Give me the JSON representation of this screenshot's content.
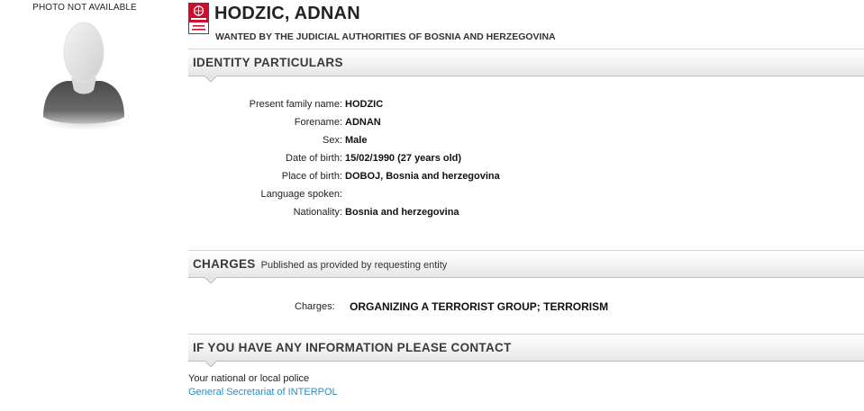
{
  "photo": {
    "caption": "PHOTO NOT AVAILABLE",
    "placeholder_icon": "person-silhouette-icon"
  },
  "header": {
    "badge_icon": "interpol-red-notice-icon",
    "badge_color": "#c8102e",
    "name": "HODZIC, ADNAN",
    "wanted_by": "WANTED BY THE JUDICIAL AUTHORITIES OF BOSNIA AND HERZEGOVINA"
  },
  "identity": {
    "title": "IDENTITY PARTICULARS",
    "rows": [
      {
        "label": "Present family name:",
        "value": "HODZIC"
      },
      {
        "label": "Forename:",
        "value": "ADNAN"
      },
      {
        "label": "Sex:",
        "value": "Male"
      },
      {
        "label": "Date of birth:",
        "value": "15/02/1990 (27 years old)"
      },
      {
        "label": "Place of birth:",
        "value": "DOBOJ, Bosnia and herzegovina"
      },
      {
        "label": "Language spoken:",
        "value": ""
      },
      {
        "label": "Nationality:",
        "value": "Bosnia and herzegovina"
      }
    ]
  },
  "charges": {
    "title": "CHARGES",
    "subtitle": "Published as provided by requesting entity",
    "label": "Charges:",
    "value": "ORGANIZING A TERRORIST GROUP; TERRORISM"
  },
  "contact": {
    "title": "IF YOU HAVE ANY INFORMATION PLEASE CONTACT",
    "police": "Your national or local police",
    "link": "General Secretariat of INTERPOL",
    "link_color": "#2a8fc0"
  }
}
